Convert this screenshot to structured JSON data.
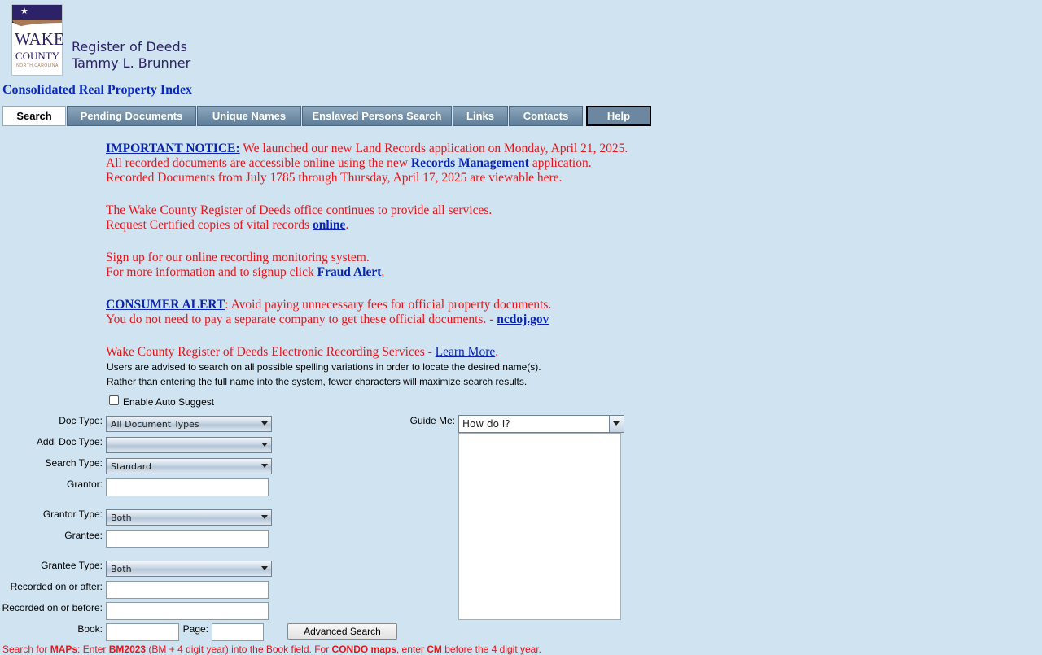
{
  "header": {
    "logo": {
      "line1": "WAKE",
      "line2": "COUNTY",
      "line3": "NORTH CAROLINA"
    },
    "office_title": "Register of Deeds",
    "office_holder": "Tammy L. Brunner",
    "page_title": "Consolidated Real Property Index"
  },
  "nav": {
    "tabs": [
      {
        "label": "Search",
        "active": true
      },
      {
        "label": "Pending Documents"
      },
      {
        "label": "Unique Names"
      },
      {
        "label": "Enslaved Persons Search"
      },
      {
        "label": "Links"
      },
      {
        "label": "Contacts"
      },
      {
        "label": "Help"
      }
    ]
  },
  "notices": {
    "n1": {
      "link": "IMPORTANT NOTICE:",
      "text1": " We launched our new Land Records application on Monday, April 21, 2025.",
      "text2": "All recorded documents are accessible online using the new ",
      "link2": "Records Management",
      "text3": " application.",
      "text4": "Recorded Documents from July 1785 through Thursday, April 17, 2025 are viewable here."
    },
    "n2": {
      "text1": "The Wake County Register of Deeds office continues to provide all services.",
      "text2": "Request Certified copies of vital records ",
      "link": "online",
      "text3": "."
    },
    "n3": {
      "text1": "Sign up for our online recording monitoring system.",
      "text2": "For more information and to signup click ",
      "link": "Fraud Alert",
      "text3": "."
    },
    "n4": {
      "link": "CONSUMER ALERT",
      "text1": ": Avoid paying unnecessary fees for official property documents.",
      "text2": "You do not need to pay a separate company to get these official documents. - ",
      "link2": "ncdoj.gov"
    },
    "n5": {
      "text1": "Wake County Register of Deeds Electronic Recording Services - ",
      "link": "Learn More",
      "text2": "."
    }
  },
  "advice": {
    "line1": "Users are advised to search on all possible spelling variations in order to locate the desired name(s).",
    "line2": "Rather than entering the full name into the system, fewer characters will maximize search results."
  },
  "form": {
    "auto_suggest_label": "Enable Auto Suggest",
    "auto_suggest_checked": false,
    "doc_type": {
      "label": "Doc Type:",
      "value": "All Document Types"
    },
    "addl_doc_type": {
      "label": "Addl Doc Type:",
      "value": ""
    },
    "search_type": {
      "label": "Search Type:",
      "value": "Standard"
    },
    "grantor": {
      "label": "Grantor:",
      "value": ""
    },
    "grantor_type": {
      "label": "Grantor Type:",
      "value": "Both"
    },
    "grantee": {
      "label": "Grantee:",
      "value": ""
    },
    "grantee_type": {
      "label": "Grantee Type:",
      "value": "Both"
    },
    "recorded_after": {
      "label": "Recorded on or after:",
      "value": ""
    },
    "recorded_before": {
      "label": "Recorded on or before:",
      "value": ""
    },
    "book": {
      "label": "Book:",
      "value": ""
    },
    "page": {
      "label": "Page:",
      "value": ""
    },
    "advanced_search_label": "Advanced Search",
    "guide_me": {
      "label": "Guide Me:",
      "value": "How do I?"
    }
  },
  "bottom_note": {
    "t1": "Search for ",
    "b1": "MAPs",
    "t2": ": Enter ",
    "b2": "BM2023",
    "t3": " (BM + 4 digit year) into the Book field. For ",
    "b3": "CONDO maps",
    "t4": ", enter ",
    "b4": "CM",
    "t5": " before the 4 digit year."
  },
  "colors": {
    "background": "#cfe3f1",
    "notice_red": "#e8161c",
    "link_blue": "#0a24b0",
    "tab_blue": "#6d87a0",
    "brand_navy": "#2d2168"
  }
}
